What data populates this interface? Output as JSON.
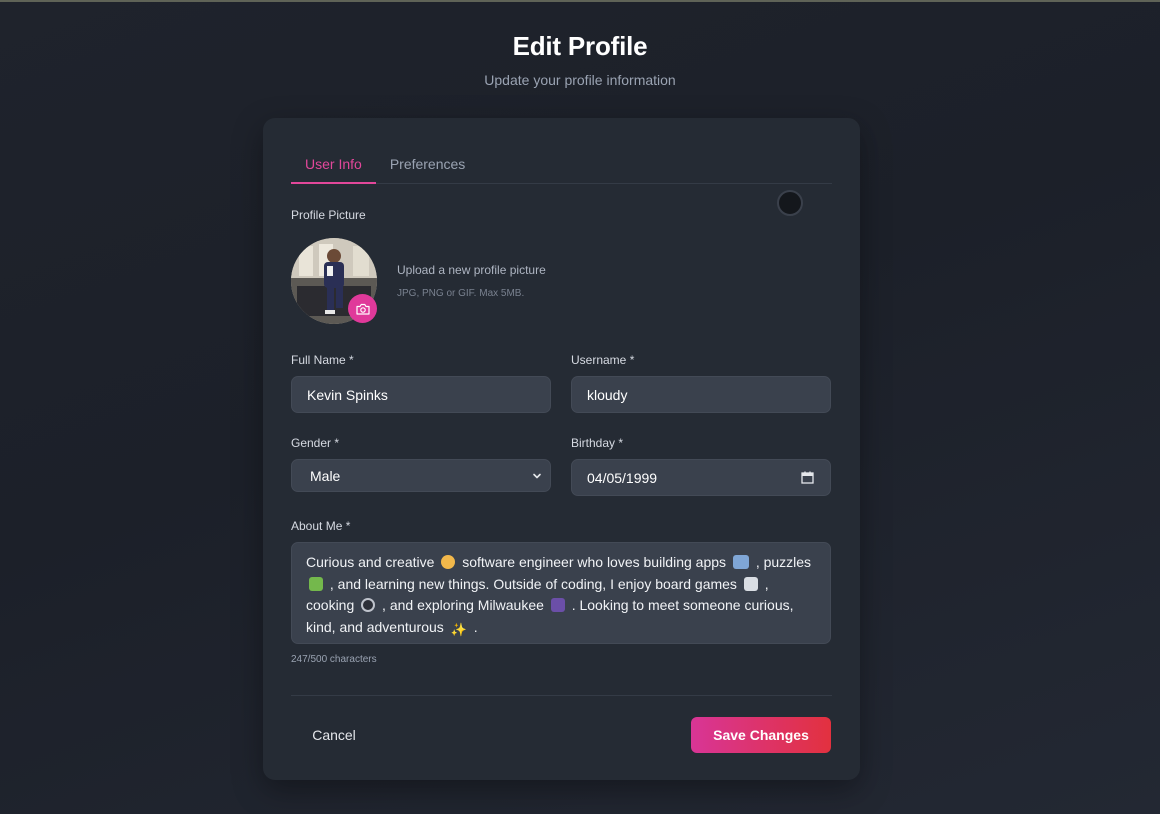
{
  "header": {
    "title": "Edit Profile",
    "subtitle": "Update your profile information"
  },
  "tabs": [
    {
      "label": "User Info",
      "active": true
    },
    {
      "label": "Preferences",
      "active": false
    }
  ],
  "profile_picture": {
    "label": "Profile Picture",
    "upload_title": "Upload a new profile picture",
    "upload_hint": "JPG, PNG or GIF. Max 5MB.",
    "camera_icon": "camera-icon"
  },
  "fields": {
    "full_name": {
      "label": "Full Name *",
      "value": "Kevin Spinks"
    },
    "username": {
      "label": "Username *",
      "value": "kloudy"
    },
    "gender": {
      "label": "Gender *",
      "value": "Male"
    },
    "birthday": {
      "label": "Birthday *",
      "value": "04/05/1999"
    }
  },
  "about": {
    "label": "About Me *",
    "segments": [
      "Curious and creative",
      "software engineer who loves building apps",
      ", puzzles",
      ", and learning new things. Outside of coding, I enjoy board games",
      ",",
      "cooking",
      ", and exploring Milwaukee",
      ". Looking to meet someone curious, kind, and adventurous",
      "."
    ],
    "char_count": "247/500 characters"
  },
  "actions": {
    "cancel_label": "Cancel",
    "save_label": "Save Changes"
  },
  "colors": {
    "accent": "#e2479a",
    "background": "#1f232c",
    "card": "#252b34",
    "input": "#3a414d"
  }
}
